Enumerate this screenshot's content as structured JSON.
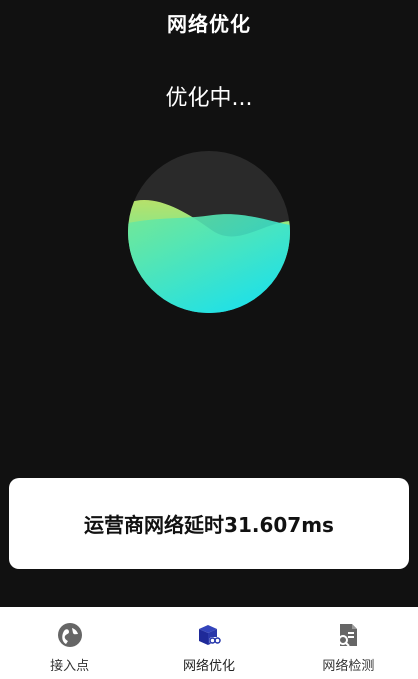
{
  "header": {
    "title": "网络优化"
  },
  "status": {
    "text": "优化中..."
  },
  "wave": {
    "fill_level": 0.6,
    "colors": {
      "circle_bg": "#2a2a2a",
      "top_green": "#b7e06a",
      "mid_green": "#6ee89a",
      "cyan": "#12e0f0"
    }
  },
  "latency_card": {
    "text": "运营商网络延时31.607ms"
  },
  "bottom_nav": {
    "items": [
      {
        "label": "接入点",
        "icon": "globe-pin-icon",
        "active": false
      },
      {
        "label": "网络优化",
        "icon": "box-link-icon",
        "active": true
      },
      {
        "label": "网络检测",
        "icon": "document-search-icon",
        "active": false
      }
    ],
    "active_color": "#2233aa",
    "inactive_color": "#666666"
  }
}
